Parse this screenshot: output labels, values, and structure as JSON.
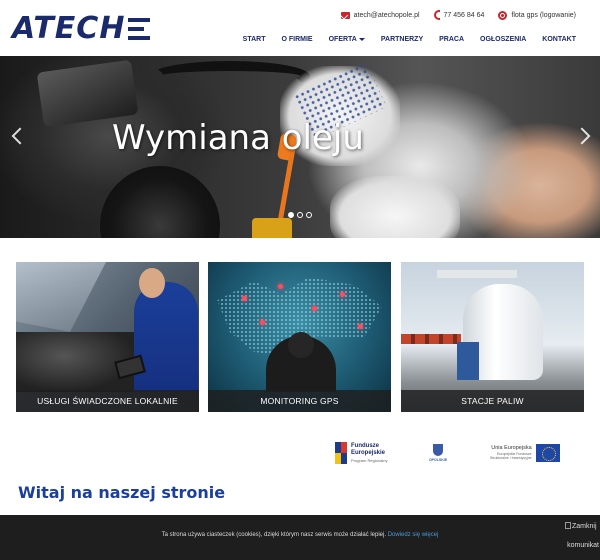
{
  "brand": {
    "logo_text": "ATECH",
    "primary_color": "#1b2a6b",
    "accent_color": "#c9252c"
  },
  "topinfo": {
    "email": "atech@atechopole.pl",
    "phone": "77 456 84 64",
    "gps": "flota gps (logowanie)"
  },
  "nav": {
    "items": [
      "START",
      "O FIRMIE",
      "OFERTA",
      "PARTNERZY",
      "PRACA",
      "OGŁOSZENIA",
      "KONTAKT"
    ]
  },
  "hero": {
    "title": "Wymiana oleju",
    "slide_count": 3,
    "active_slide": 1,
    "icons": {
      "prev": "chevron-left-icon",
      "next": "chevron-right-icon"
    }
  },
  "tiles": [
    {
      "caption": "USŁUGI ŚWIADCZONE LOKALNIE"
    },
    {
      "caption": "MONITORING GPS"
    },
    {
      "caption": "STACJE PALIW"
    }
  ],
  "eu": {
    "fe_line1": "Fundusze",
    "fe_line2": "Europejskie",
    "fe_line3": "Program Regionalny",
    "opolskie": "OPOLSKIE",
    "ue_line1": "Unia Europejska",
    "ue_line2": "Europejskie Fundusze",
    "ue_line3": "Strukturalne i Inwestycyjne"
  },
  "welcome": {
    "heading": "Witaj na naszej stronie"
  },
  "cookie": {
    "text": "Ta strona używa ciasteczek (cookies), dzięki którym nasz serwis może działać lepiej.",
    "link": "Dowiedz się więcej",
    "close_line1": "Zamknij",
    "close_line2": "komunikat"
  }
}
